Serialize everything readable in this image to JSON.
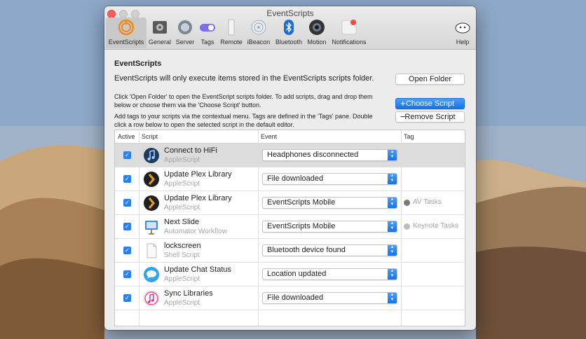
{
  "window": {
    "title": "EventScripts"
  },
  "toolbar": {
    "items": [
      {
        "label": "EventScripts",
        "icon": "eventscripts-icon",
        "active": true
      },
      {
        "label": "General",
        "icon": "general-icon"
      },
      {
        "label": "Server",
        "icon": "server-icon"
      },
      {
        "label": "Tags",
        "icon": "tags-icon"
      },
      {
        "label": "Remote",
        "icon": "remote-icon"
      },
      {
        "label": "iBeacon",
        "icon": "ibeacon-icon"
      },
      {
        "label": "Bluetooth",
        "icon": "bluetooth-icon"
      },
      {
        "label": "Motion",
        "icon": "motion-icon"
      },
      {
        "label": "Notifications",
        "icon": "notifications-icon"
      }
    ],
    "help_label": "Help"
  },
  "content": {
    "heading": "EventScripts",
    "intro": "EventScripts will only execute items stored in the EventScripts scripts folder.",
    "help1": "Click 'Open Folder' to open the EventScript scripts folder. To add scripts, drag and drop them below or choose them via the 'Choose Script' button.",
    "help2": "Add tags to your scripts via the contextual menu. Tags are defined in the 'Tags' pane. Double click a row below to open the selected script in the default editor.",
    "open_folder": "Open Folder",
    "choose_script": "Choose Script",
    "remove_script": "Remove Script"
  },
  "table": {
    "headers": {
      "active": "Active",
      "script": "Script",
      "event": "Event",
      "tag": "Tag"
    },
    "rows": [
      {
        "active": true,
        "name": "Connect to HiFi",
        "type": "AppleScript",
        "event": "Headphones disconnected",
        "tag": "",
        "icon": "itunes-note-icon",
        "selected": true
      },
      {
        "active": true,
        "name": "Update Plex Library",
        "type": "AppleScript",
        "event": "File downloaded",
        "tag": "",
        "icon": "plex-icon"
      },
      {
        "active": true,
        "name": "Update Plex Library",
        "type": "AppleScript",
        "event": "EventScripts Mobile",
        "tag": "AV Tasks",
        "tag_color": "#7a7a7a",
        "icon": "plex-icon"
      },
      {
        "active": true,
        "name": "Next Slide",
        "type": "Automator Workflow",
        "event": "EventScripts Mobile",
        "tag": "Keynote Tasks",
        "tag_color": "#bdbdbd",
        "icon": "keynote-icon"
      },
      {
        "active": true,
        "name": "lockscreen",
        "type": "Shell Script",
        "event": "Bluetooth device found",
        "tag": "",
        "icon": "document-icon"
      },
      {
        "active": true,
        "name": "Update Chat Status",
        "type": "AppleScript",
        "event": "Location updated",
        "tag": "",
        "icon": "messages-icon"
      },
      {
        "active": true,
        "name": "Sync Libraries",
        "type": "AppleScript",
        "event": "File downloaded",
        "tag": "",
        "icon": "itunes-icon"
      }
    ]
  },
  "colors": {
    "accent": "#2b7ff1",
    "close": "#fc5f57"
  }
}
